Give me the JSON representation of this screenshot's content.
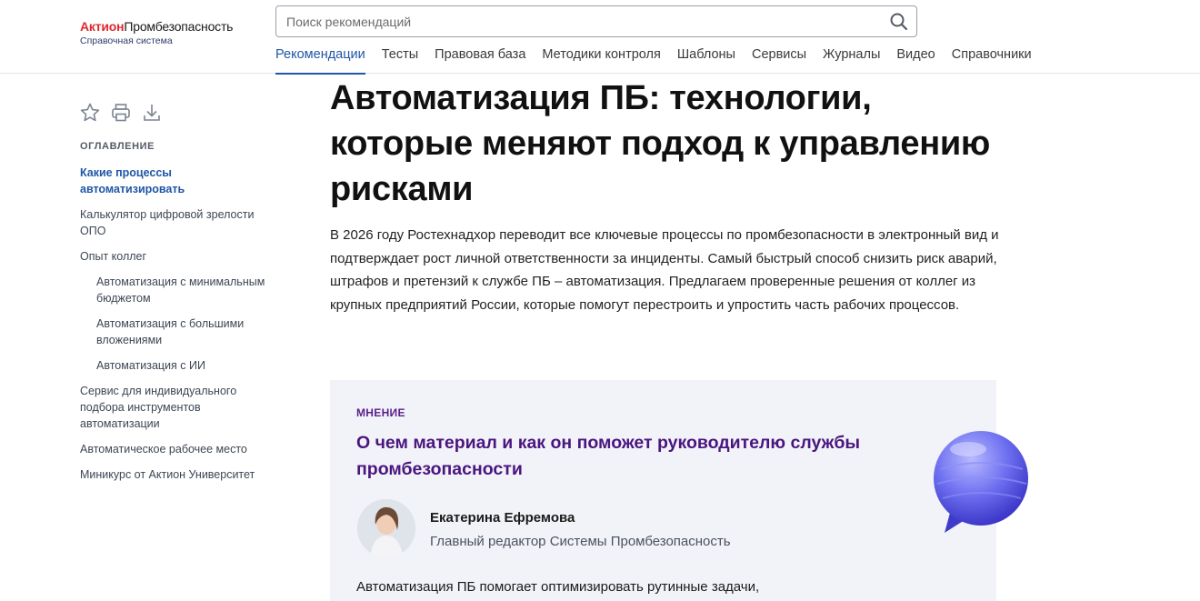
{
  "logo": {
    "brand": "Актион",
    "product": "Промбезопасность",
    "subtitle": "Справочная система"
  },
  "search": {
    "placeholder": "Поиск рекомендаций"
  },
  "nav": [
    {
      "label": "Рекомендации",
      "active": true
    },
    {
      "label": "Тесты"
    },
    {
      "label": "Правовая база"
    },
    {
      "label": "Методики контроля"
    },
    {
      "label": "Шаблоны"
    },
    {
      "label": "Сервисы"
    },
    {
      "label": "Журналы"
    },
    {
      "label": "Видео"
    },
    {
      "label": "Справочники"
    }
  ],
  "toc": {
    "title": "ОГЛАВЛЕНИЕ",
    "items": [
      {
        "label": "Какие процессы автоматизировать",
        "active": true
      },
      {
        "label": "Калькулятор цифровой зрелости ОПО"
      },
      {
        "label": "Опыт коллег"
      },
      {
        "label": "Автоматизация с минимальным бюджетом",
        "sub": true
      },
      {
        "label": "Автоматизация с большими вложениями",
        "sub": true
      },
      {
        "label": "Автоматизация с ИИ",
        "sub": true
      },
      {
        "label": "Сервис для индивидуального подбора инструментов автоматизации"
      },
      {
        "label": "Автоматическое рабочее место"
      },
      {
        "label": "Миникурс от Актион Университет"
      }
    ]
  },
  "article": {
    "title": "Автоматизация ПБ: технологии, которые меняют подход к управлению рисками",
    "lead": "В 2026 году Ростехнадхор переводит все ключевые процессы по промбезопасности в электронный вид и подтверждает рост личной ответственности за инциденты. Самый быстрый способ снизить риск аварий, штрафов и претензий к службе ПБ – автоматизация. Предлагаем проверенные решения от коллег из крупных предприятий России, которые помогут перестроить и упростить часть рабочих процессов."
  },
  "opinion": {
    "label": "МНЕНИЕ",
    "title": "О чем материал и как он поможет руководителю службы промбезопасности",
    "author_name": "Екатерина Ефремова",
    "author_role": "Главный редактор Системы Промбезопасность",
    "text": "Автоматизация ПБ помогает оптимизировать рутинные задачи,"
  },
  "colors": {
    "accent": "#1f56a6",
    "brand_red": "#e0292e",
    "opinion_title": "#4a167f",
    "opinion_bg": "#f2f3f8"
  }
}
